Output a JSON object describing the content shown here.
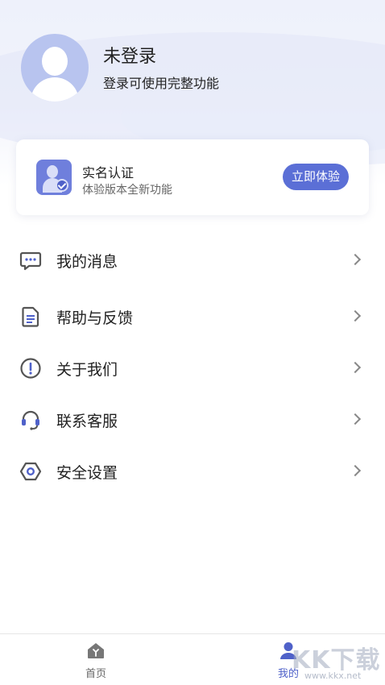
{
  "profile": {
    "name": "未登录",
    "subtitle": "登录可使用完整功能"
  },
  "verify_card": {
    "title": "实名认证",
    "subtitle": "体验版本全新功能",
    "button": "立即体验"
  },
  "menu": [
    {
      "label": "我的消息",
      "icon": "message-icon"
    },
    {
      "label": "帮助与反馈",
      "icon": "document-icon"
    },
    {
      "label": "关于我们",
      "icon": "info-icon"
    },
    {
      "label": "联系客服",
      "icon": "headset-icon"
    },
    {
      "label": "安全设置",
      "icon": "settings-hexagon-icon"
    }
  ],
  "tabbar": {
    "home": "首页",
    "mine": "我的"
  },
  "watermark": {
    "text": "KK下载",
    "url": "www.kkx.net"
  },
  "colors": {
    "accent": "#5b6fd6",
    "avatar": "#b8c4ef",
    "active_tab": "#4f61c9"
  }
}
